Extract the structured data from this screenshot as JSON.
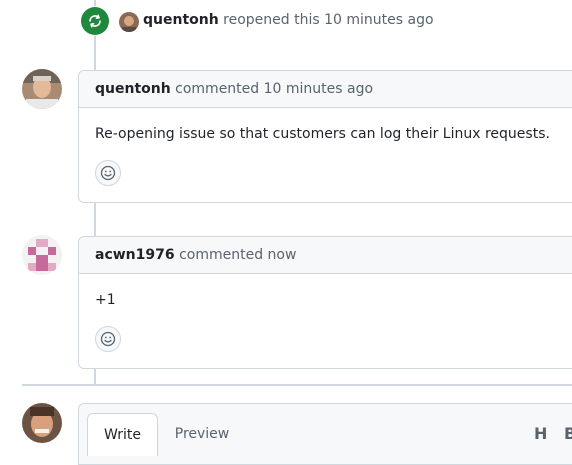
{
  "reopen_event": {
    "author": "quentonh",
    "action": "reopened this",
    "time": "10 minutes ago",
    "badge_color": "#1f883d",
    "icon": "sync-icon"
  },
  "comments": [
    {
      "author": "quentonh",
      "action": "commented",
      "time": "10 minutes ago",
      "body": "Re-opening issue so that customers can log their Linux requests.",
      "reaction_icon": "smiley-icon"
    },
    {
      "author": "acwn1976",
      "action": "commented",
      "time": "now",
      "body": "+1",
      "reaction_icon": "smiley-icon"
    }
  ],
  "editor": {
    "tabs": [
      "Write",
      "Preview"
    ],
    "active_tab": "Write",
    "toolbar": [
      "H",
      "B"
    ]
  }
}
